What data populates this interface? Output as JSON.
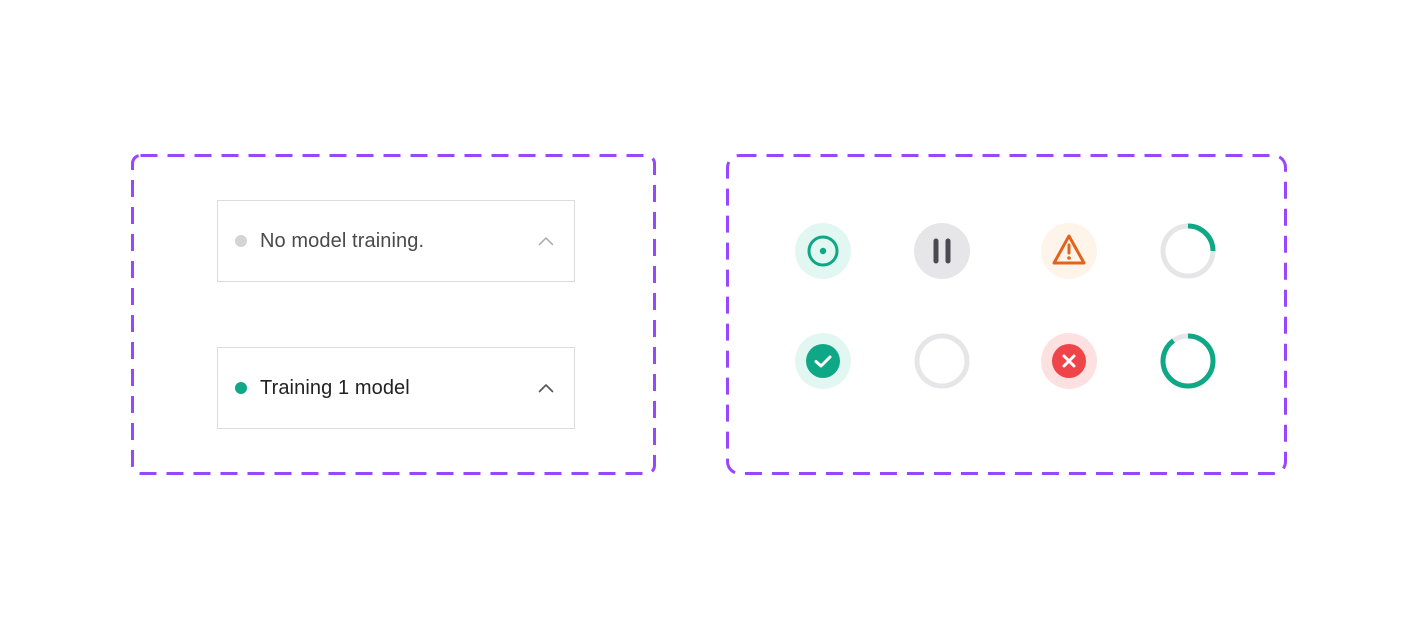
{
  "colors": {
    "frame_border": "#9747FF",
    "dropdown_border": "#dcdcdc",
    "success": "#0FA886",
    "success_bg": "#E3F7F2",
    "neutral_bg": "#E6E6E9",
    "neutral_fg": "#4A4A52",
    "warning": "#E0641E",
    "warning_bg": "#FFF4EA",
    "error": "#EE444A",
    "error_bg": "#FDE1E1",
    "track": "#E6E6E8",
    "text_muted": "#4A4A4A",
    "text_primary": "#222222",
    "dot_idle": "#D4D4D6",
    "chevron_muted": "#A8A8A8",
    "chevron_active": "#555555"
  },
  "dropdowns": [
    {
      "label": "No model training.",
      "status": "idle",
      "status_dot_icon": "status-dot-idle",
      "chevron_icon": "chevron-up-icon"
    },
    {
      "label": "Training 1 model",
      "status": "training",
      "status_dot_icon": "status-dot-active",
      "chevron_icon": "chevron-up-icon"
    }
  ],
  "status_icons": [
    {
      "name": "running-icon",
      "state": "running",
      "row": 1,
      "col": 1
    },
    {
      "name": "paused-icon",
      "state": "paused",
      "row": 1,
      "col": 2
    },
    {
      "name": "warning-icon",
      "state": "warning",
      "row": 1,
      "col": 3
    },
    {
      "name": "progress-ring-icon",
      "state": "in-progress",
      "progress": 0.25,
      "row": 1,
      "col": 4
    },
    {
      "name": "success-check-icon",
      "state": "completed",
      "row": 2,
      "col": 1
    },
    {
      "name": "pending-ring-icon",
      "state": "pending",
      "row": 2,
      "col": 2
    },
    {
      "name": "error-x-icon",
      "state": "failed",
      "row": 2,
      "col": 3
    },
    {
      "name": "progress-ring-icon",
      "state": "in-progress",
      "progress": 0.9,
      "row": 2,
      "col": 4
    }
  ]
}
